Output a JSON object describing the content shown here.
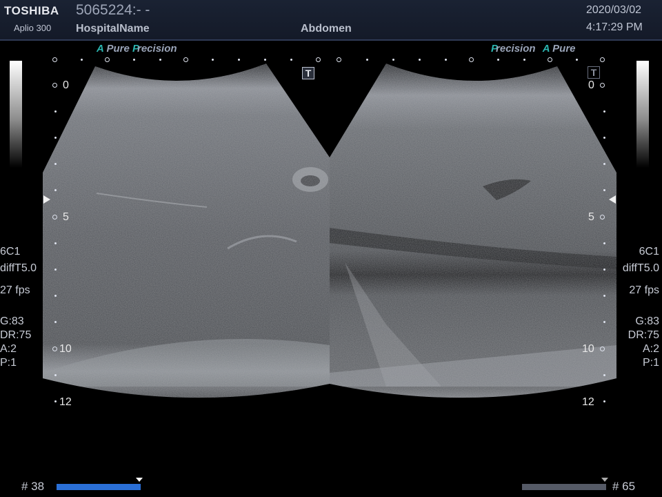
{
  "header": {
    "brand": "TOSHIBA",
    "model": "Aplio 300",
    "patient_id": "5065224:- -",
    "hospital": "HospitalName",
    "preset": "Abdomen",
    "date": "2020/03/02",
    "time": "4:17:29 PM"
  },
  "left_panel": {
    "tag_a": "A",
    "tag_pure": "Pure",
    "tag_p": "P",
    "tag_precision": "recision",
    "probe": "6C1",
    "mode": "diffT5.0",
    "fps": "27 fps",
    "gain": "G:83",
    "dr": "DR:75",
    "a": "A:2",
    "p": "P:1",
    "depths": [
      "0",
      "5",
      "10",
      "12"
    ],
    "t_icon": "T",
    "cine_label": "# 38",
    "cine_fill": 1.0
  },
  "right_panel": {
    "tag_p": "P",
    "tag_precision": "recision",
    "tag_a": "A",
    "tag_pure": "Pure",
    "probe": "6C1",
    "mode": "diffT5.0",
    "fps": "27 fps",
    "gain": "G:83",
    "dr": "DR:75",
    "a": "A:2",
    "p": "P:1",
    "depths": [
      "0",
      "5",
      "10",
      "12"
    ],
    "t_icon": "T",
    "cine_label": "# 65",
    "cine_fill": 1.0
  },
  "colors": {
    "cine_left": "#2a6fd6",
    "cine_right": "#555a66",
    "tag_accent": "#2bb5b0"
  }
}
